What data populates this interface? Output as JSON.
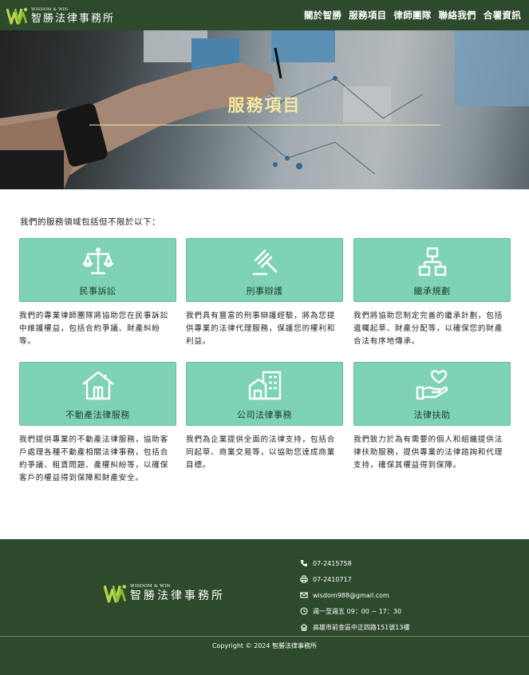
{
  "header": {
    "logo": {
      "en": "WISDOM & WIN",
      "zh": "智勝法律事務所"
    },
    "nav": [
      "關於智勝",
      "服務項目",
      "律師團隊",
      "聯絡我們",
      "合署資訊"
    ]
  },
  "hero": {
    "title": "服務項目"
  },
  "intro": "我們的服務領域包括但不限於以下：",
  "services": [
    {
      "label": "民事訴訟",
      "icon": "scale-icon",
      "desc": "我們的專業律師團隊將協助您在民事訴訟中維護權益，包括合約爭議、財產糾紛等。"
    },
    {
      "label": "刑事辯護",
      "icon": "gavel-icon",
      "desc": "我們具有豐富的刑事辯護經驗，將為您提供專業的法律代理服務，保護您的權利和利益。"
    },
    {
      "label": "繼承規劃",
      "icon": "hierarchy-icon",
      "desc": "我們將協助您制定完善的繼承計劃，包括遺囑起草、財產分配等，以確保您的財產合法有序地傳承。"
    },
    {
      "label": "不動產法律服務",
      "icon": "house-icon",
      "desc": "我們提供專業的不動產法律服務，協助客戶處理各種不動產相關法律事務，包括合約爭議、租賃問題、產權糾紛等，以確保客戶的權益得到保障和財產安全。"
    },
    {
      "label": "公司法律事務",
      "icon": "building-icon",
      "desc": "我們為企業提供全面的法律支持，包括合同起草、商業交易等，以協助您達成商業目標。"
    },
    {
      "label": "法律扶助",
      "icon": "heart-hand-icon",
      "desc": "我們致力於為有需要的個人和組織提供法律扶助服務，提供專業的法律諮詢和代理支持，確保其權益得到保障。"
    }
  ],
  "footer": {
    "logo": {
      "en": "WISDOM & WIN",
      "zh": "智勝法律事務所"
    },
    "phone": "07-2415758",
    "fax": "07-2410717",
    "email": "wisdom988@gmail.com",
    "hours": "週一至週五 09：00 ~ 17：30",
    "address": "高雄市前金區中正四路151號13樓",
    "copyright": "Copyright © 2024 智勝法律事務所"
  },
  "colors": {
    "header_bg": "#2d4a2d",
    "card_bg": "#7dd3b3",
    "hero_title": "#f5e8a0"
  }
}
